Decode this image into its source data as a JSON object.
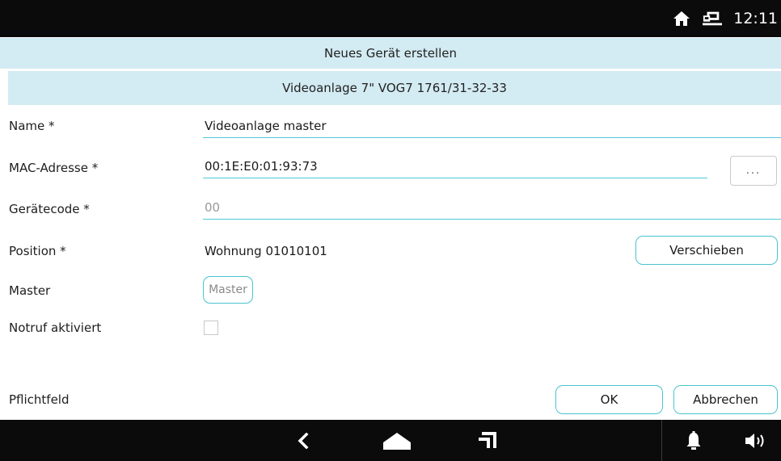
{
  "status_bar": {
    "time": "12:11",
    "icons": [
      "home-icon",
      "network-icon"
    ]
  },
  "header": {
    "title": "Neues Gerät erstellen",
    "subtitle": "Videoanlage 7\" VOG7 1761/31-32-33"
  },
  "form": {
    "name": {
      "label": "Name *",
      "value": "Videoanlage master"
    },
    "mac": {
      "label": "MAC-Adresse *",
      "value": "00:1E:E0:01:93:73",
      "browse_label": "..."
    },
    "device_code": {
      "label": "Gerätecode *",
      "placeholder": "00"
    },
    "position": {
      "label": "Position *",
      "value": "Wohnung 01010101",
      "move_label": "Verschieben"
    },
    "master": {
      "label": "Master",
      "button_label": "Master"
    },
    "emergency": {
      "label": "Notruf aktiviert",
      "checked": false
    }
  },
  "footer": {
    "required_note": "Pflichtfeld",
    "ok_label": "OK",
    "cancel_label": "Abbrechen"
  },
  "nav_bar": {
    "icons": [
      "back-icon",
      "home-icon",
      "recent-apps-icon",
      "bell-icon",
      "speaker-icon"
    ]
  },
  "colors": {
    "accent": "#49c3cf",
    "header_bg": "#d3ebf2",
    "bar_bg": "#0b0b0b"
  }
}
